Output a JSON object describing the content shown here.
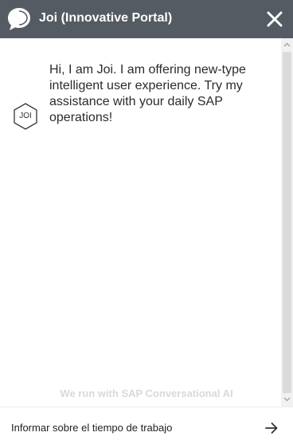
{
  "header": {
    "title": "Joi (Innovative Portal)",
    "logo_icon": "speech-bubble-icon",
    "close_icon": "close-icon",
    "background": "#555b62"
  },
  "conversation": {
    "avatar_text": "JOI",
    "message": "Hi, I am Joi. I am offering new-type intelligent user experience. Try my assistance with your daily SAP operations!"
  },
  "footer": {
    "powered_by": "We run with SAP Conversational AI"
  },
  "composer": {
    "input_value": "Informar sobre el tiempo de trabajo",
    "send_icon": "arrow-right-icon"
  }
}
